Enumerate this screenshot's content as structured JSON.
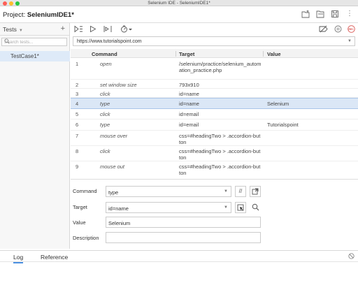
{
  "window": {
    "title": "Selenium IDE - SeleniumIDE1*"
  },
  "project": {
    "label": "Project:",
    "name": "SeleniumIDE1*"
  },
  "sidebar": {
    "title": "Tests",
    "search_placeholder": "Search tests...",
    "tests": [
      {
        "name": "TestCase1*"
      }
    ]
  },
  "toolbar": {
    "icons": [
      "run-all-icon",
      "run-current-icon",
      "step-icon",
      "speed-icon",
      "disable-breakpoints-icon",
      "pause-exceptions-icon",
      "record-icon"
    ],
    "record_label": "REC"
  },
  "url": {
    "value": "https://www.tutorialspoint.com"
  },
  "grid": {
    "headers": {
      "command": "Command",
      "target": "Target",
      "value": "Value"
    },
    "rows": [
      {
        "num": "1",
        "command": "open",
        "target_lines": [
          "/selenium/practice/selenium_autom",
          "ation_practice.php"
        ],
        "value": ""
      },
      {
        "num": "2",
        "command": "set window size",
        "target_lines": [
          "793x910"
        ],
        "value": ""
      },
      {
        "num": "3",
        "command": "click",
        "target_lines": [
          "id=name"
        ],
        "value": ""
      },
      {
        "num": "4",
        "command": "type",
        "target_lines": [
          "id=name"
        ],
        "value": "Selenium"
      },
      {
        "num": "5",
        "command": "click",
        "target_lines": [
          "id=email"
        ],
        "value": ""
      },
      {
        "num": "6",
        "command": "type",
        "target_lines": [
          "id=email"
        ],
        "value": "Tutorialspoint"
      },
      {
        "num": "7",
        "command": "mouse over",
        "target_lines": [
          "css=#headingTwo > .accordion-but",
          "ton"
        ],
        "value": ""
      },
      {
        "num": "8",
        "command": "click",
        "target_lines": [
          "css=#headingTwo > .accordion-but",
          "ton"
        ],
        "value": ""
      },
      {
        "num": "9",
        "command": "mouse out",
        "target_lines": [
          "css=#headingTwo > .accordion-but",
          "ton"
        ],
        "value": ""
      }
    ],
    "selected_row": "4"
  },
  "editor": {
    "command_label": "Command",
    "command_value": "type",
    "comment_button": "//",
    "target_label": "Target",
    "target_value": "id=name",
    "value_label": "Value",
    "value_value": "Selenium",
    "description_label": "Description",
    "description_value": ""
  },
  "bottom": {
    "tabs": [
      "Log",
      "Reference"
    ],
    "active_tab": "Log"
  },
  "colors": {
    "selected_row": "#dbe7f6",
    "accent": "#4a90e2",
    "record": "#d9534f"
  }
}
